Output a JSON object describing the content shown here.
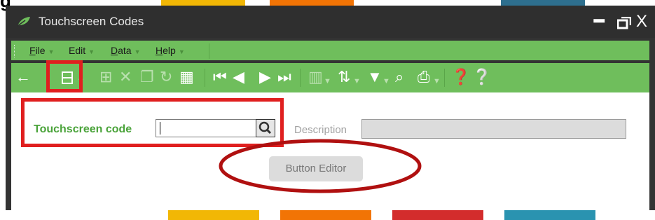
{
  "cut_heading": "g",
  "window": {
    "title": "Touchscreen Codes",
    "controls": {
      "minimize": "━",
      "restore": "▭",
      "close": "X"
    }
  },
  "menu": {
    "items": [
      {
        "label": "File",
        "underline": "F",
        "rest": "ile"
      },
      {
        "label": "Edit",
        "underline": "",
        "rest": "Edit"
      },
      {
        "label": "Data",
        "underline": "D",
        "rest": "ata"
      },
      {
        "label": "Help",
        "underline": "H",
        "rest": "elp"
      }
    ]
  },
  "toolbar": {
    "icons": [
      "back-arrow-icon",
      "save-icon",
      "add-icon",
      "delete-icon",
      "copy-icon",
      "refresh-icon",
      "table-icon",
      "first-record-icon",
      "previous-record-icon",
      "next-record-icon",
      "last-record-icon",
      "columns-icon",
      "sort-icon",
      "filter-icon",
      "find-icon",
      "print-icon",
      "help-icon",
      "context-help-icon"
    ]
  },
  "form": {
    "code_label": "Touchscreen code",
    "code_value": "",
    "description_label": "Description",
    "description_value": "",
    "button_editor_label": "Button Editor"
  },
  "colors": {
    "accent_green": "#6fbe5c",
    "label_green": "#4aa33a",
    "annotation_red": "#e01f1f",
    "annotation_dark_red": "#b01010"
  }
}
